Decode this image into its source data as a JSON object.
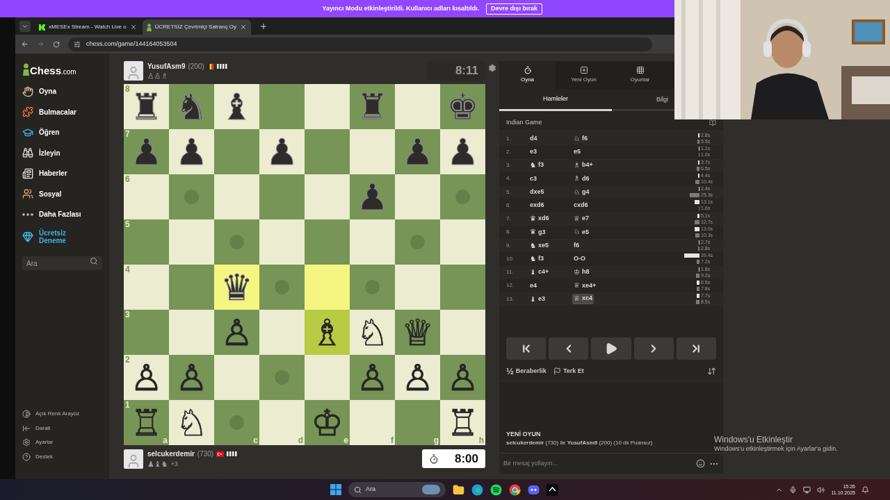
{
  "banner": {
    "text": "Yayıncı Modu etkinleştirildi. Kullanıcı adları kısaltıldı.",
    "button": "Devre dışı bırak"
  },
  "browser": {
    "tabs": [
      {
        "title": "xMESEx Stream - Watch Live o",
        "selected": false,
        "kind": "stream"
      },
      {
        "title": "ÜCRETSİZ Çevrimiçi Satranç Oy",
        "selected": true,
        "kind": "chess"
      }
    ],
    "url": "chess.com/game/144164053504"
  },
  "sidebar": {
    "logo": {
      "name": "Chess",
      "suffix": ".com"
    },
    "items": [
      {
        "label": "Oyna",
        "kind": "link"
      },
      {
        "label": "Bulmacalar",
        "kind": "link"
      },
      {
        "label": "Öğren",
        "kind": "link"
      },
      {
        "label": "İzleyin",
        "kind": "link"
      },
      {
        "label": "Haberler",
        "kind": "link"
      },
      {
        "label": "Sosyal",
        "kind": "link"
      },
      {
        "label": "Daha Fazlası",
        "kind": "link"
      },
      {
        "label": "Ücretsiz Deneme",
        "kind": "promo"
      }
    ],
    "search": {
      "placeholder": "Ara"
    },
    "footer": [
      {
        "label": "Açık Renk Arayüz"
      },
      {
        "label": "Daralt"
      },
      {
        "label": "Ayarlar"
      },
      {
        "label": "Destek"
      }
    ]
  },
  "top_player": {
    "name": "YusufAsm9",
    "rating": "(200)",
    "flag": {
      "kind": "belgium"
    },
    "captured": [
      "♙",
      "♙",
      "♗"
    ],
    "clock": {
      "time": "8:11",
      "active": false
    }
  },
  "bottom_player": {
    "name": "selcukerdemir",
    "rating": "(730)",
    "flag": {
      "kind": "turkey"
    },
    "captured": [
      "♟",
      "♝",
      "♞"
    ],
    "advantage": "+3",
    "clock": {
      "time": "8:00",
      "active": true
    }
  },
  "board": {
    "ranks": [
      [
        {
          "piece": "♜",
          "kind": "black",
          "highlighted": false,
          "move_dot": false,
          "rank_label": "8"
        },
        {
          "piece": "♞",
          "kind": "black",
          "highlighted": false,
          "move_dot": false
        },
        {
          "piece": "♝",
          "kind": "black",
          "highlighted": false,
          "move_dot": false
        },
        {
          "highlighted": false,
          "move_dot": false
        },
        {
          "highlighted": false,
          "move_dot": false
        },
        {
          "piece": "♜",
          "kind": "black",
          "highlighted": false,
          "move_dot": false
        },
        {
          "highlighted": false,
          "move_dot": false
        },
        {
          "piece": "♚",
          "kind": "black",
          "highlighted": false,
          "move_dot": false
        }
      ],
      [
        {
          "piece": "♟",
          "kind": "black",
          "highlighted": false,
          "move_dot": false,
          "rank_label": "7"
        },
        {
          "piece": "♟",
          "kind": "black",
          "highlighted": false,
          "move_dot": false
        },
        {
          "highlighted": false,
          "move_dot": false
        },
        {
          "piece": "♟",
          "kind": "black",
          "highlighted": false,
          "move_dot": false
        },
        {
          "highlighted": false,
          "move_dot": false
        },
        {
          "highlighted": false,
          "move_dot": false
        },
        {
          "piece": "♟",
          "kind": "black",
          "highlighted": false,
          "move_dot": false
        },
        {
          "piece": "♟",
          "kind": "black",
          "highlighted": false,
          "move_dot": false
        }
      ],
      [
        {
          "highlighted": false,
          "move_dot": false,
          "rank_label": "6"
        },
        {
          "highlighted": false,
          "move_dot": true
        },
        {
          "highlighted": false,
          "move_dot": false
        },
        {
          "highlighted": false,
          "move_dot": false
        },
        {
          "highlighted": false,
          "move_dot": false
        },
        {
          "piece": "♟",
          "kind": "black",
          "highlighted": false,
          "move_dot": false
        },
        {
          "highlighted": false,
          "move_dot": false
        },
        {
          "highlighted": false,
          "move_dot": true
        }
      ],
      [
        {
          "highlighted": false,
          "move_dot": false,
          "rank_label": "5"
        },
        {
          "highlighted": false,
          "move_dot": false
        },
        {
          "highlighted": false,
          "move_dot": true
        },
        {
          "highlighted": false,
          "move_dot": false
        },
        {
          "highlighted": false,
          "move_dot": false
        },
        {
          "highlighted": false,
          "move_dot": false
        },
        {
          "highlighted": false,
          "move_dot": true
        },
        {
          "highlighted": false,
          "move_dot": false
        }
      ],
      [
        {
          "highlighted": false,
          "move_dot": false,
          "rank_label": "4"
        },
        {
          "highlighted": false,
          "move_dot": false
        },
        {
          "piece": "♛",
          "kind": "black",
          "highlighted": true,
          "move_dot": false
        },
        {
          "highlighted": false,
          "move_dot": true
        },
        {
          "highlighted": true,
          "move_dot": false
        },
        {
          "highlighted": false,
          "move_dot": true
        },
        {
          "highlighted": false,
          "move_dot": false
        },
        {
          "highlighted": false,
          "move_dot": false
        }
      ],
      [
        {
          "highlighted": false,
          "move_dot": false,
          "rank_label": "3"
        },
        {
          "highlighted": false,
          "move_dot": false
        },
        {
          "piece": "♙",
          "kind": "white",
          "highlighted": false,
          "move_dot": false
        },
        {
          "highlighted": false,
          "move_dot": false
        },
        {
          "piece": "♗",
          "kind": "white",
          "highlighted": true,
          "move_dot": false
        },
        {
          "piece": "♘",
          "kind": "white",
          "highlighted": false,
          "move_dot": false
        },
        {
          "piece": "♕",
          "kind": "white",
          "highlighted": false,
          "move_dot": false
        },
        {
          "highlighted": false,
          "move_dot": false
        }
      ],
      [
        {
          "piece": "♙",
          "kind": "white",
          "highlighted": false,
          "move_dot": false,
          "rank_label": "2"
        },
        {
          "piece": "♙",
          "kind": "white",
          "highlighted": false,
          "move_dot": false
        },
        {
          "highlighted": false,
          "move_dot": false
        },
        {
          "highlighted": false,
          "move_dot": true
        },
        {
          "highlighted": false,
          "move_dot": false
        },
        {
          "piece": "♙",
          "kind": "white",
          "highlighted": false,
          "move_dot": false
        },
        {
          "piece": "♙",
          "kind": "white",
          "highlighted": false,
          "move_dot": false
        },
        {
          "piece": "♙",
          "kind": "white",
          "highlighted": false,
          "move_dot": false
        }
      ],
      [
        {
          "piece": "♖",
          "kind": "white",
          "highlighted": false,
          "move_dot": false,
          "rank_label": "1",
          "file_label": "a"
        },
        {
          "piece": "♘",
          "kind": "white",
          "highlighted": false,
          "move_dot": false
        },
        {
          "highlighted": false,
          "move_dot": true,
          "file_label": "c"
        },
        {
          "highlighted": false,
          "move_dot": false,
          "file_label": "d"
        },
        {
          "piece": "♔",
          "kind": "white",
          "highlighted": false,
          "move_dot": false,
          "file_label": "e"
        },
        {
          "highlighted": false,
          "move_dot": false,
          "file_label": "f"
        },
        {
          "highlighted": false,
          "move_dot": false,
          "file_label": "g"
        },
        {
          "piece": "♖",
          "kind": "white",
          "highlighted": false,
          "move_dot": false,
          "file_label": "h"
        }
      ]
    ]
  },
  "game_tabs": [
    {
      "label": "Oyna",
      "selected": true
    },
    {
      "label": "Yeni Oyun",
      "selected": false
    },
    {
      "label": "Oyunlar",
      "selected": false
    }
  ],
  "move_tabs": [
    {
      "label": "Hamleler",
      "selected": true
    },
    {
      "label": "Bilgi",
      "selected": false
    }
  ],
  "opening": "Indian Game",
  "moves": [
    {
      "number": "1.",
      "white": {
        "san": "d4",
        "selected": false
      },
      "black": {
        "piece": "♘",
        "san": "f6",
        "selected": false
      },
      "times": [
        {
          "text": "2.8s"
        },
        {
          "text": "5.5s"
        }
      ]
    },
    {
      "number": "2.",
      "white": {
        "san": "e3",
        "selected": false
      },
      "black": {
        "san": "e5",
        "selected": false
      },
      "times": [
        {
          "text": "1.1s"
        },
        {
          "text": "1.0s"
        }
      ]
    },
    {
      "number": "3.",
      "white": {
        "piece": "♞",
        "san": "f3",
        "selected": false
      },
      "black": {
        "piece": "♗",
        "san": "b4+",
        "selected": false
      },
      "times": [
        {
          "text": "3.7s"
        },
        {
          "text": "6.5s"
        }
      ]
    },
    {
      "number": "4.",
      "white": {
        "san": "c3",
        "selected": false
      },
      "black": {
        "piece": "♗",
        "san": "d6",
        "selected": false
      },
      "times": [
        {
          "text": "4.4s"
        },
        {
          "text": "10.4s"
        }
      ]
    },
    {
      "number": "5.",
      "white": {
        "san": "dxe5",
        "selected": false
      },
      "black": {
        "piece": "♘",
        "san": "g4",
        "selected": false
      },
      "times": [
        {
          "text": "2.4s"
        },
        {
          "text": "25.3s"
        }
      ]
    },
    {
      "number": "6.",
      "white": {
        "san": "exd6",
        "selected": false
      },
      "black": {
        "san": "cxd6",
        "selected": false
      },
      "times": [
        {
          "text": "13.1s"
        },
        {
          "text": "1.6s"
        }
      ]
    },
    {
      "number": "7.",
      "white": {
        "piece": "♛",
        "san": "xd6",
        "selected": false
      },
      "black": {
        "piece": "♕",
        "san": "e7",
        "selected": false
      },
      "times": [
        {
          "text": "5.1s"
        },
        {
          "text": "12.7s"
        }
      ]
    },
    {
      "number": "8.",
      "white": {
        "piece": "♛",
        "san": "g3",
        "selected": false
      },
      "black": {
        "piece": "♘",
        "san": "e5",
        "selected": false
      },
      "times": [
        {
          "text": "13.0s"
        },
        {
          "text": "10.3s"
        }
      ]
    },
    {
      "number": "9.",
      "white": {
        "piece": "♞",
        "san": "xe5",
        "selected": false
      },
      "black": {
        "san": "f6",
        "selected": false
      },
      "times": [
        {
          "text": "2.7s"
        },
        {
          "text": "2.8s"
        }
      ]
    },
    {
      "number": "10.",
      "white": {
        "piece": "♞",
        "san": "f3",
        "selected": false
      },
      "black": {
        "san": "O-O",
        "selected": false
      },
      "times": [
        {
          "text": "39.4s"
        },
        {
          "text": "7.2s"
        }
      ]
    },
    {
      "number": "11.",
      "white": {
        "piece": "♝",
        "san": "c4+",
        "selected": false
      },
      "black": {
        "piece": "♔",
        "san": "h8",
        "selected": false
      },
      "times": [
        {
          "text": "1.8s"
        },
        {
          "text": "9.2s"
        }
      ]
    },
    {
      "number": "12.",
      "white": {
        "san": "e4",
        "selected": false
      },
      "black": {
        "piece": "♕",
        "san": "xe4+",
        "selected": false
      },
      "times": [
        {
          "text": "6.5s"
        },
        {
          "text": "7.8s"
        }
      ]
    },
    {
      "number": "13.",
      "white": {
        "piece": "♝",
        "san": "e3",
        "selected": false
      },
      "black": {
        "piece": "♕",
        "san": "xc4",
        "selected": true
      },
      "times": [
        {
          "text": "7.7s"
        },
        {
          "text": "8.5s"
        }
      ]
    }
  ],
  "controls": {
    "draw_glyph": "½",
    "draw": "Beraberlik",
    "resign": "Terk Et"
  },
  "chat": {
    "title": "YENİ OYUN",
    "message": "**selcukerdemir** (730) ile **YusufAsm9** (200) (10 dk Puansız)",
    "placeholder": "Bir mesaj yollayın..."
  },
  "windows_notice": {
    "title": "Windows'u Etkinleştir",
    "text": "Windows'u etkinleştirmek için Ayarlar'a gidin."
  },
  "taskbar": {
    "search": "Ara",
    "time": "15:26",
    "date": "11.10.2025"
  }
}
